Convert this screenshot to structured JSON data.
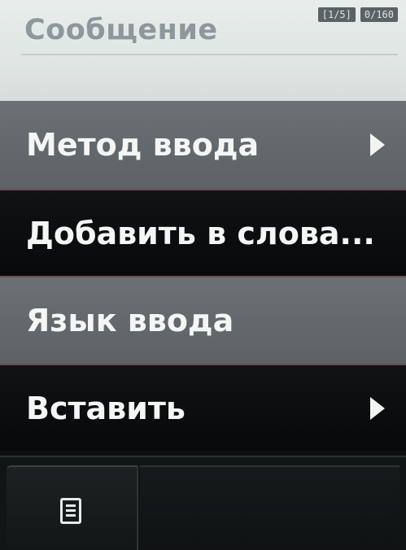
{
  "composer": {
    "title": "Сообщение",
    "page_indicator": "[1/5]",
    "char_counter": "0/160"
  },
  "menu": {
    "items": [
      {
        "label": "Метод ввода",
        "has_submenu": true
      },
      {
        "label": "Добавить в слова...",
        "has_submenu": false
      },
      {
        "label": "Язык ввода",
        "has_submenu": false
      },
      {
        "label": "Вставить",
        "has_submenu": true
      }
    ]
  },
  "softkeys": {
    "left_icon": "menu-list-icon"
  }
}
